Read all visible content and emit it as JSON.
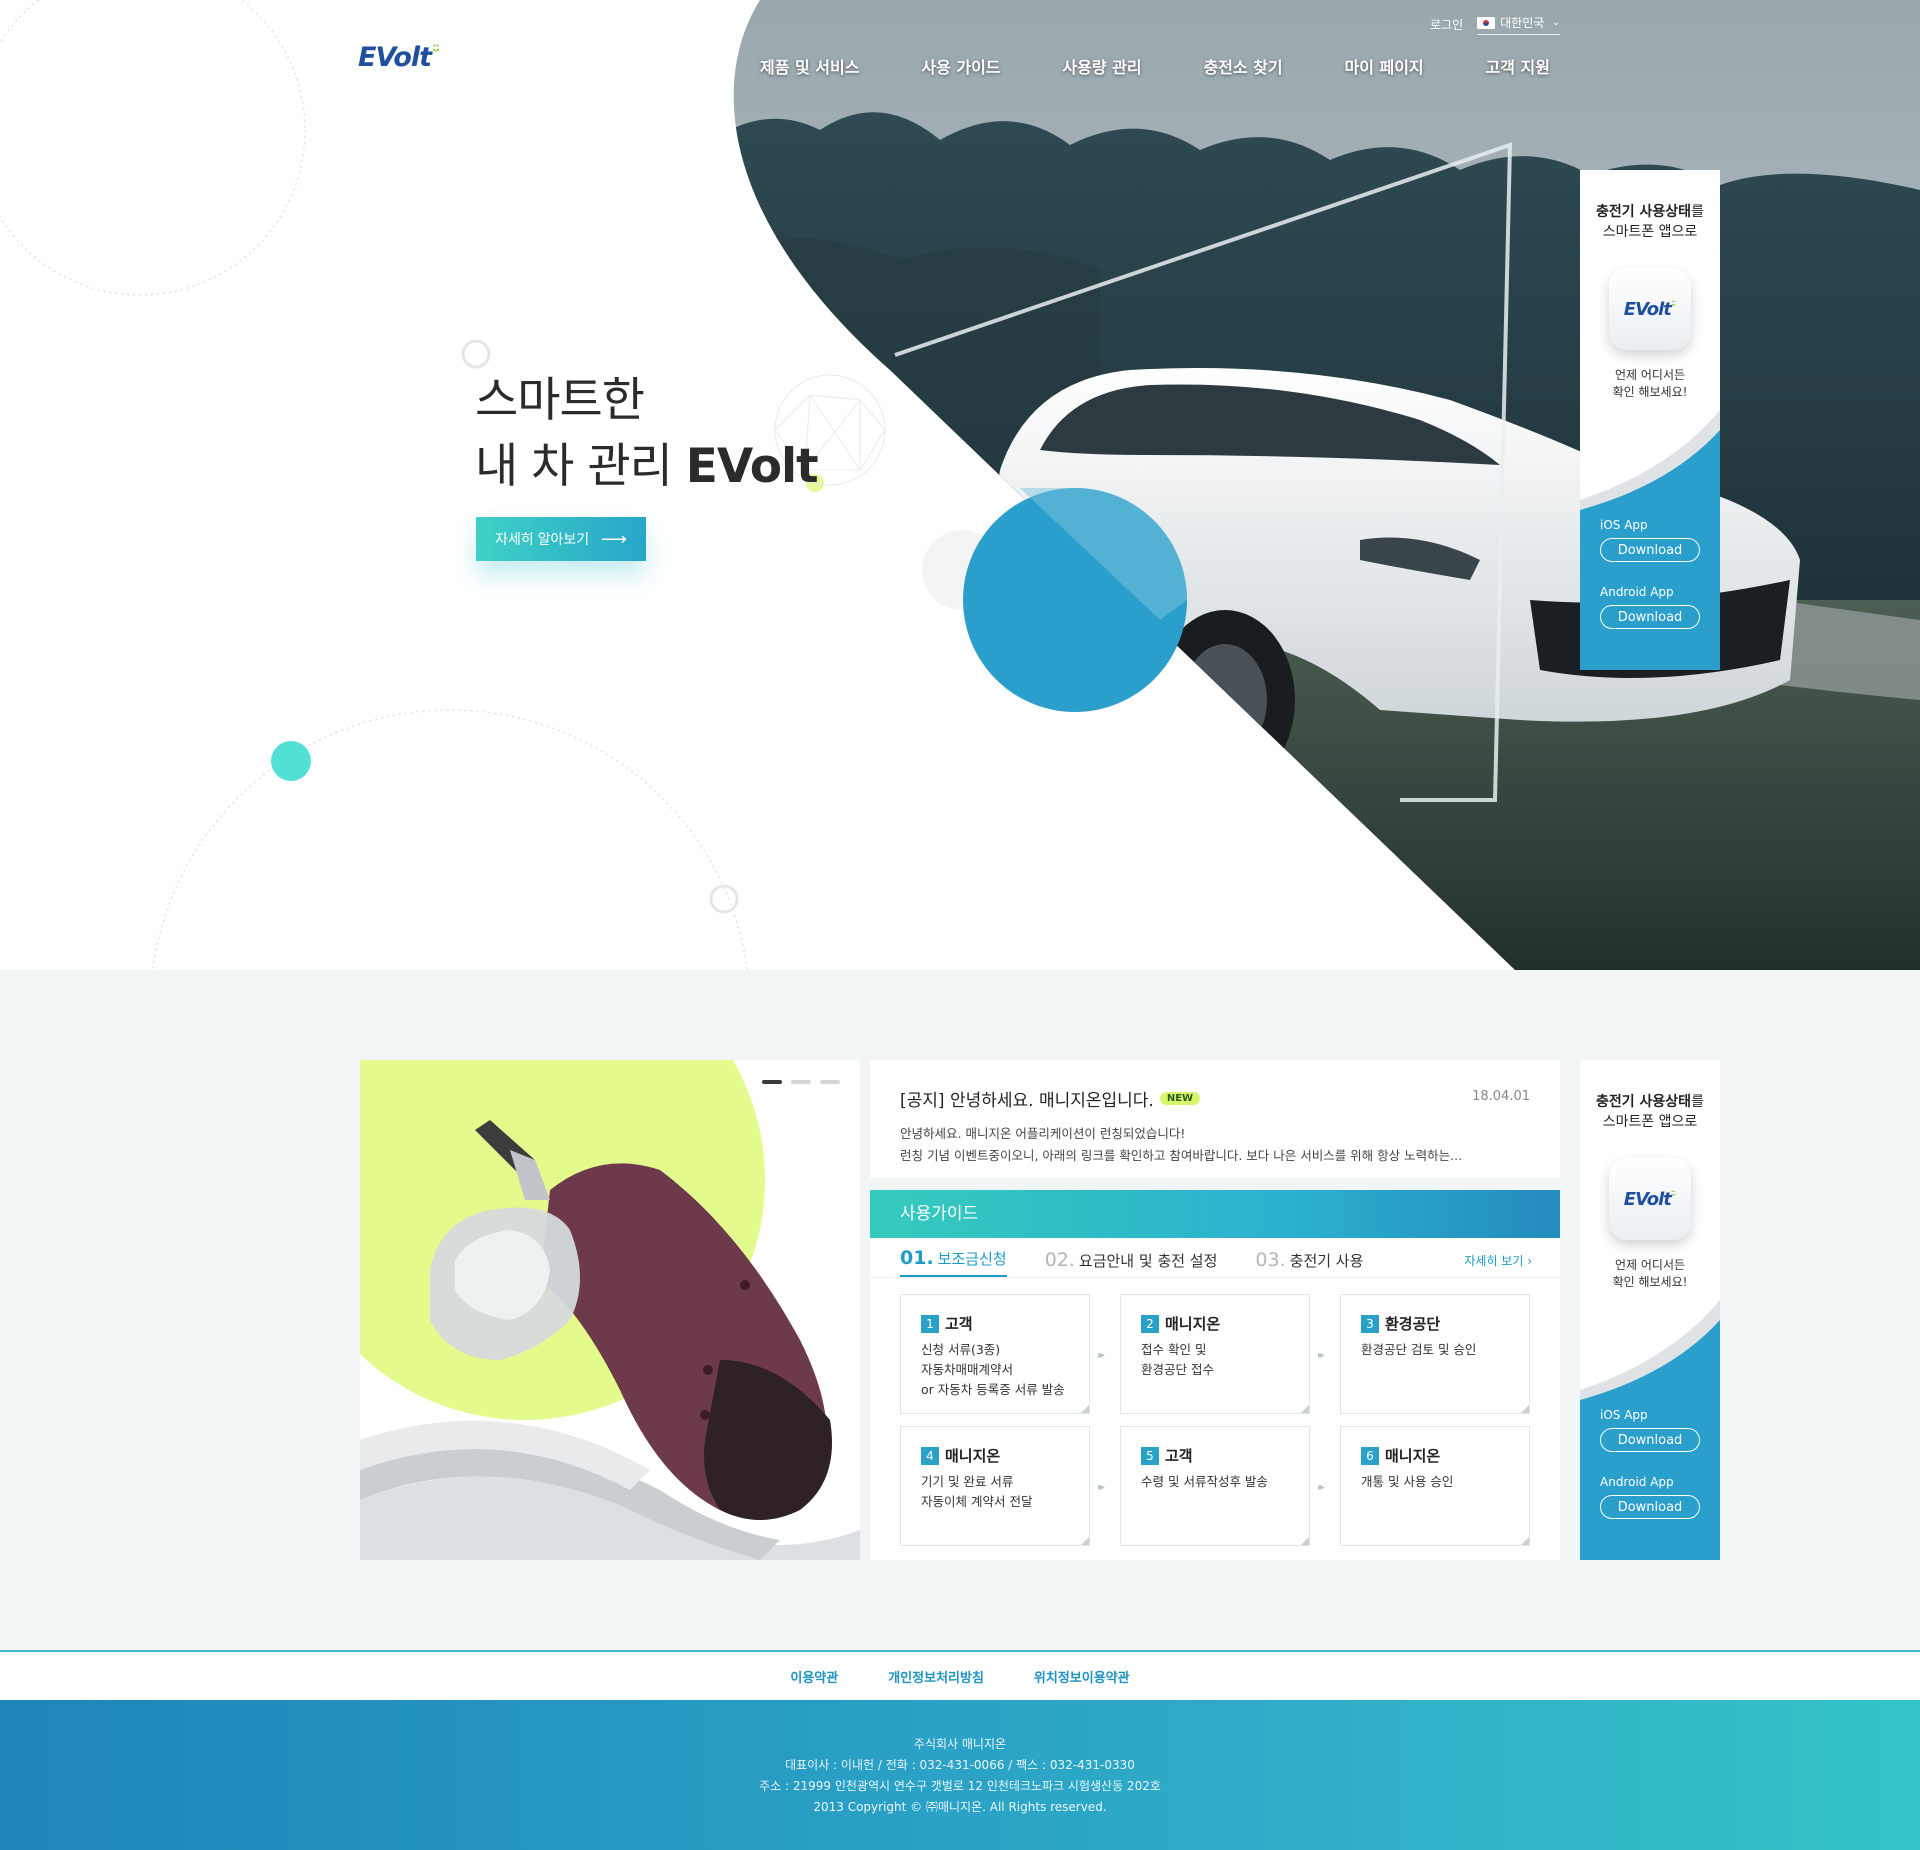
{
  "brand": {
    "logo_text": "EVolt",
    "logo_spark": "ᵕ̈"
  },
  "util": {
    "login": "로그인",
    "language": "대한민국"
  },
  "nav": [
    "제품 및 서비스",
    "사용 가이드",
    "사용량 관리",
    "충전소 찾기",
    "마이 페이지",
    "고객 지원"
  ],
  "hero": {
    "line1": "스마트한",
    "line2_prefix": "내 차 관리 ",
    "line2_brand": "EVolt",
    "cta": "자세히 알아보기"
  },
  "app_banner": {
    "title_bold": "충전기 사용상태",
    "title_rest": "를",
    "title_line2": "스마트폰 앱으로",
    "sub_line1": "언제 어디서든",
    "sub_line2": "확인 해보세요!",
    "ios_label": "iOS App",
    "android_label": "Android App",
    "download": "Download"
  },
  "notice": {
    "title": "[공지] 안녕하세요. 매니지온입니다.",
    "badge": "NEW",
    "date": "18.04.01",
    "line1": "안녕하세요. 매니지온 어플리케이션이 런칭되었습니다!",
    "line2": "런칭 기념 이벤트중이오니, 아래의 링크를 확인하고 참여바랍니다. 보다 나은 서비스를 위해 항상 노력하는..."
  },
  "guide": {
    "title": "사용가이드",
    "tabs": [
      {
        "num": "01.",
        "label": "보조금신청"
      },
      {
        "num": "02.",
        "label": "요금안내 및 충전 설정"
      },
      {
        "num": "03.",
        "label": "충전기 사용"
      }
    ],
    "more": "자세히 보기 ›",
    "steps": [
      {
        "num": "1",
        "title": "고객",
        "lines": [
          "신청 서류(3종)",
          "자동차매매계약서",
          "or 자동차 등록증 서류 발송"
        ]
      },
      {
        "num": "2",
        "title": "매니지온",
        "lines": [
          "접수 확인 및",
          "환경공단 접수"
        ]
      },
      {
        "num": "3",
        "title": "환경공단",
        "lines": [
          "환경공단 검토 및 승인"
        ]
      },
      {
        "num": "4",
        "title": "매니지온",
        "lines": [
          "기기 및 완료 서류",
          "자동이체 계약서 전달"
        ]
      },
      {
        "num": "5",
        "title": "고객",
        "lines": [
          "수령 및 서류작성후 발송"
        ]
      },
      {
        "num": "6",
        "title": "매니지온",
        "lines": [
          "개통 및 사용 승인"
        ]
      }
    ]
  },
  "footer_links": [
    "이용약관",
    "개인정보처리방침",
    "위치정보이용약관"
  ],
  "footer": {
    "company": "주식회사 매니지온",
    "contact": "대표이사 : 이내헌 / 전화 : 032-431-0066 / 팩스 : 032-431-0330",
    "address": "주소 : 21999 인천광역시 연수구 갯벌로 12 인천테크노파크 시험생산동 202호",
    "copyright": "2013 Copyright © ㈜매니지온. All Rights reserved."
  },
  "colors": {
    "accent_teal": "#3fd1c7",
    "accent_blue": "#2aa2c8",
    "logo_blue": "#1f4f9e",
    "logo_green": "#8cc63f",
    "lime": "#e2fb8c"
  }
}
